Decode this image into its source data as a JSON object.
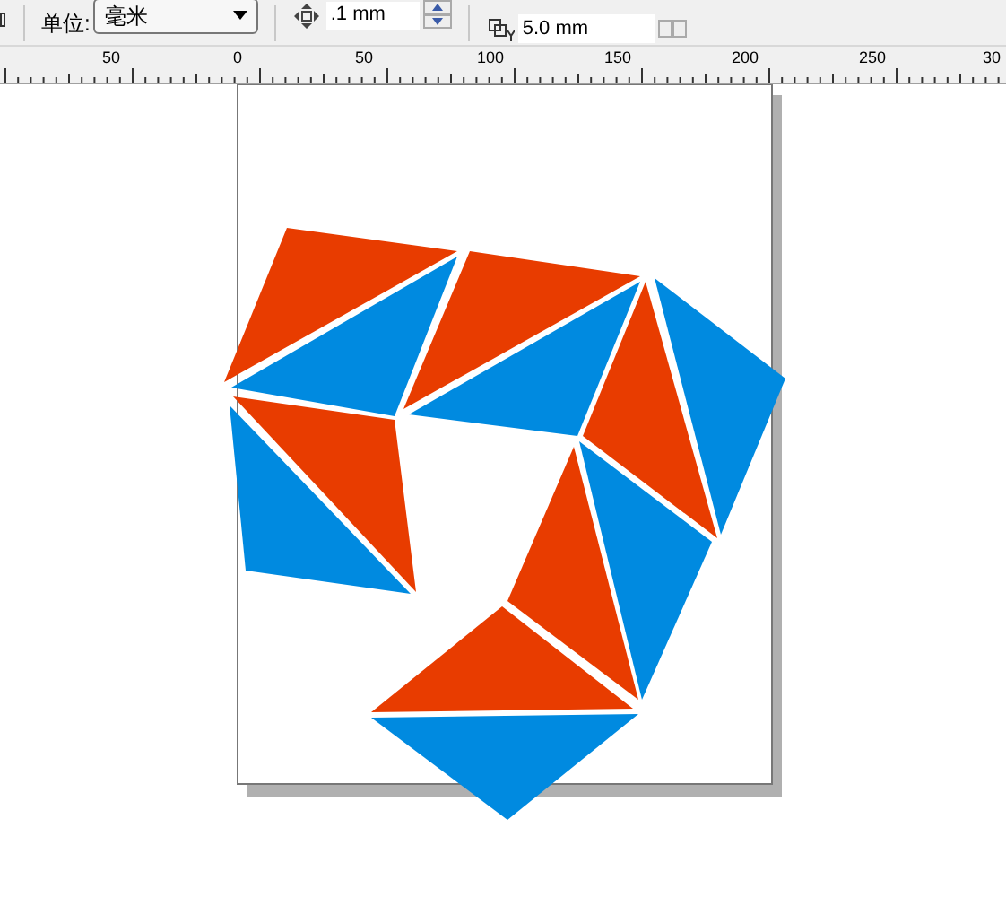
{
  "toolbar": {
    "unit_label": "单位:",
    "unit_select": "毫米",
    "nudge_field": ".1 mm",
    "duplicate_y_field": "5.0 mm"
  },
  "ruler": {
    "labels": [
      "50",
      "0",
      "50",
      "100",
      "150",
      "200",
      "250",
      "30"
    ]
  }
}
